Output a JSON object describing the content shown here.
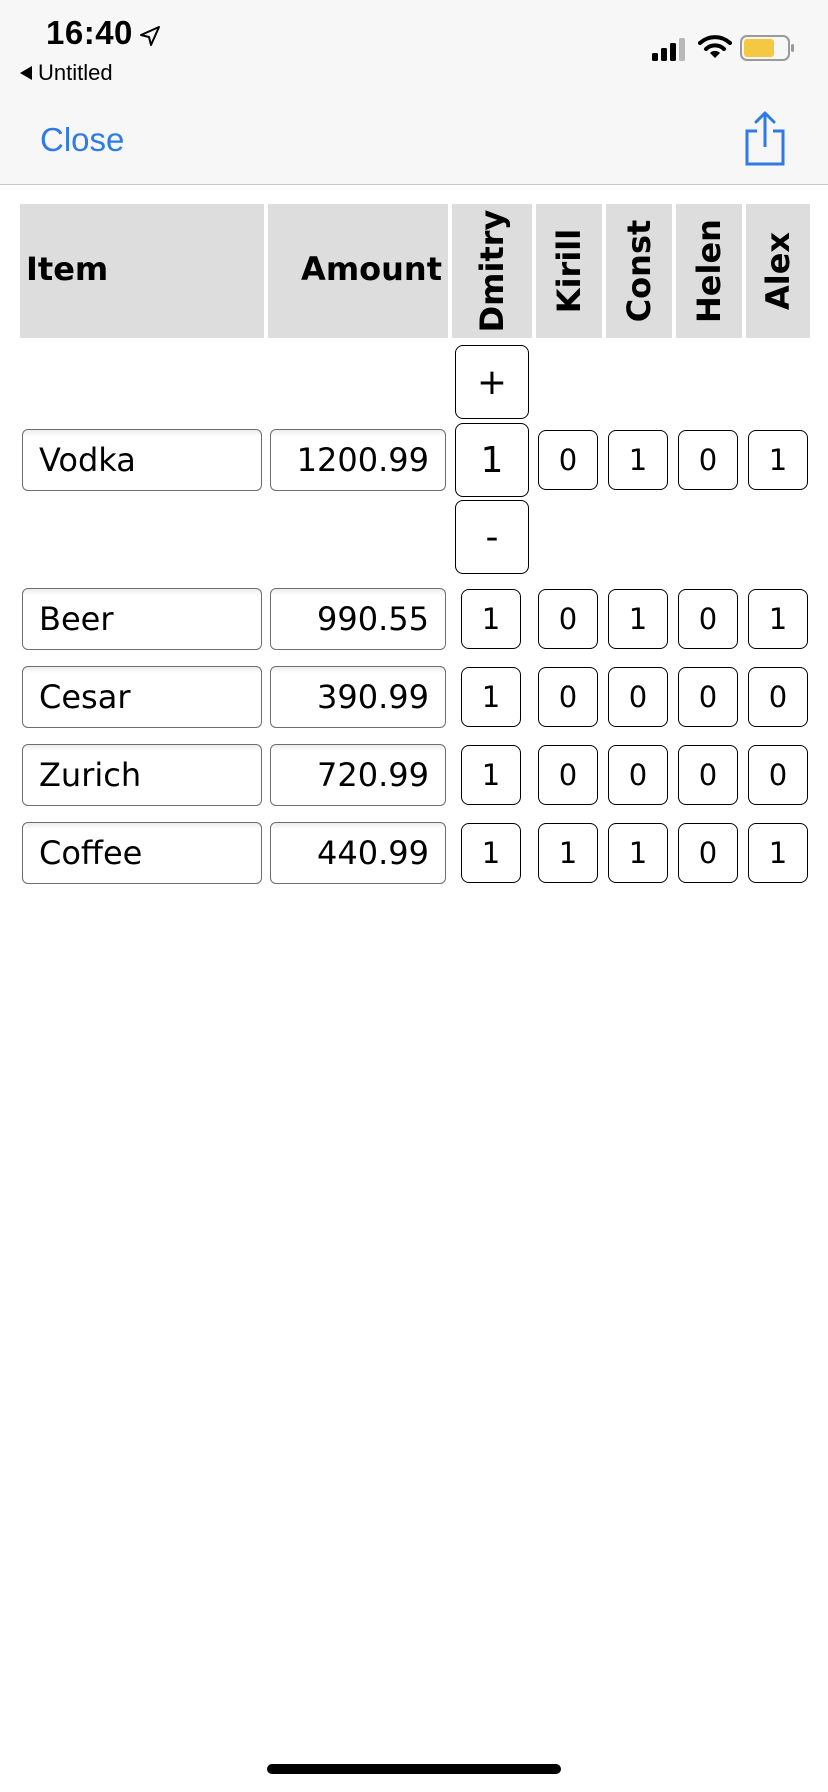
{
  "status_bar": {
    "time": "16:40",
    "back_app": "Untitled",
    "battery_color": "#f5c842"
  },
  "nav": {
    "close_label": "Close"
  },
  "table": {
    "headers": {
      "item": "Item",
      "amount": "Amount",
      "people": [
        "Dmitry",
        "Kirill",
        "Const",
        "Helen",
        "Alex"
      ]
    },
    "stepper": {
      "plus": "+",
      "minus": "-"
    },
    "rows": [
      {
        "item": "Vodka",
        "amount": "1200.99",
        "counts": [
          "1",
          "0",
          "1",
          "0",
          "1"
        ]
      },
      {
        "item": "Beer",
        "amount": "990.55",
        "counts": [
          "1",
          "0",
          "1",
          "0",
          "1"
        ]
      },
      {
        "item": "Cesar",
        "amount": "390.99",
        "counts": [
          "1",
          "0",
          "0",
          "0",
          "0"
        ]
      },
      {
        "item": "Zurich",
        "amount": "720.99",
        "counts": [
          "1",
          "0",
          "0",
          "0",
          "0"
        ]
      },
      {
        "item": "Coffee",
        "amount": "440.99",
        "counts": [
          "1",
          "1",
          "1",
          "0",
          "1"
        ]
      }
    ]
  },
  "colors": {
    "accent": "#2f7ae5",
    "header_bg": "#dddddd"
  }
}
